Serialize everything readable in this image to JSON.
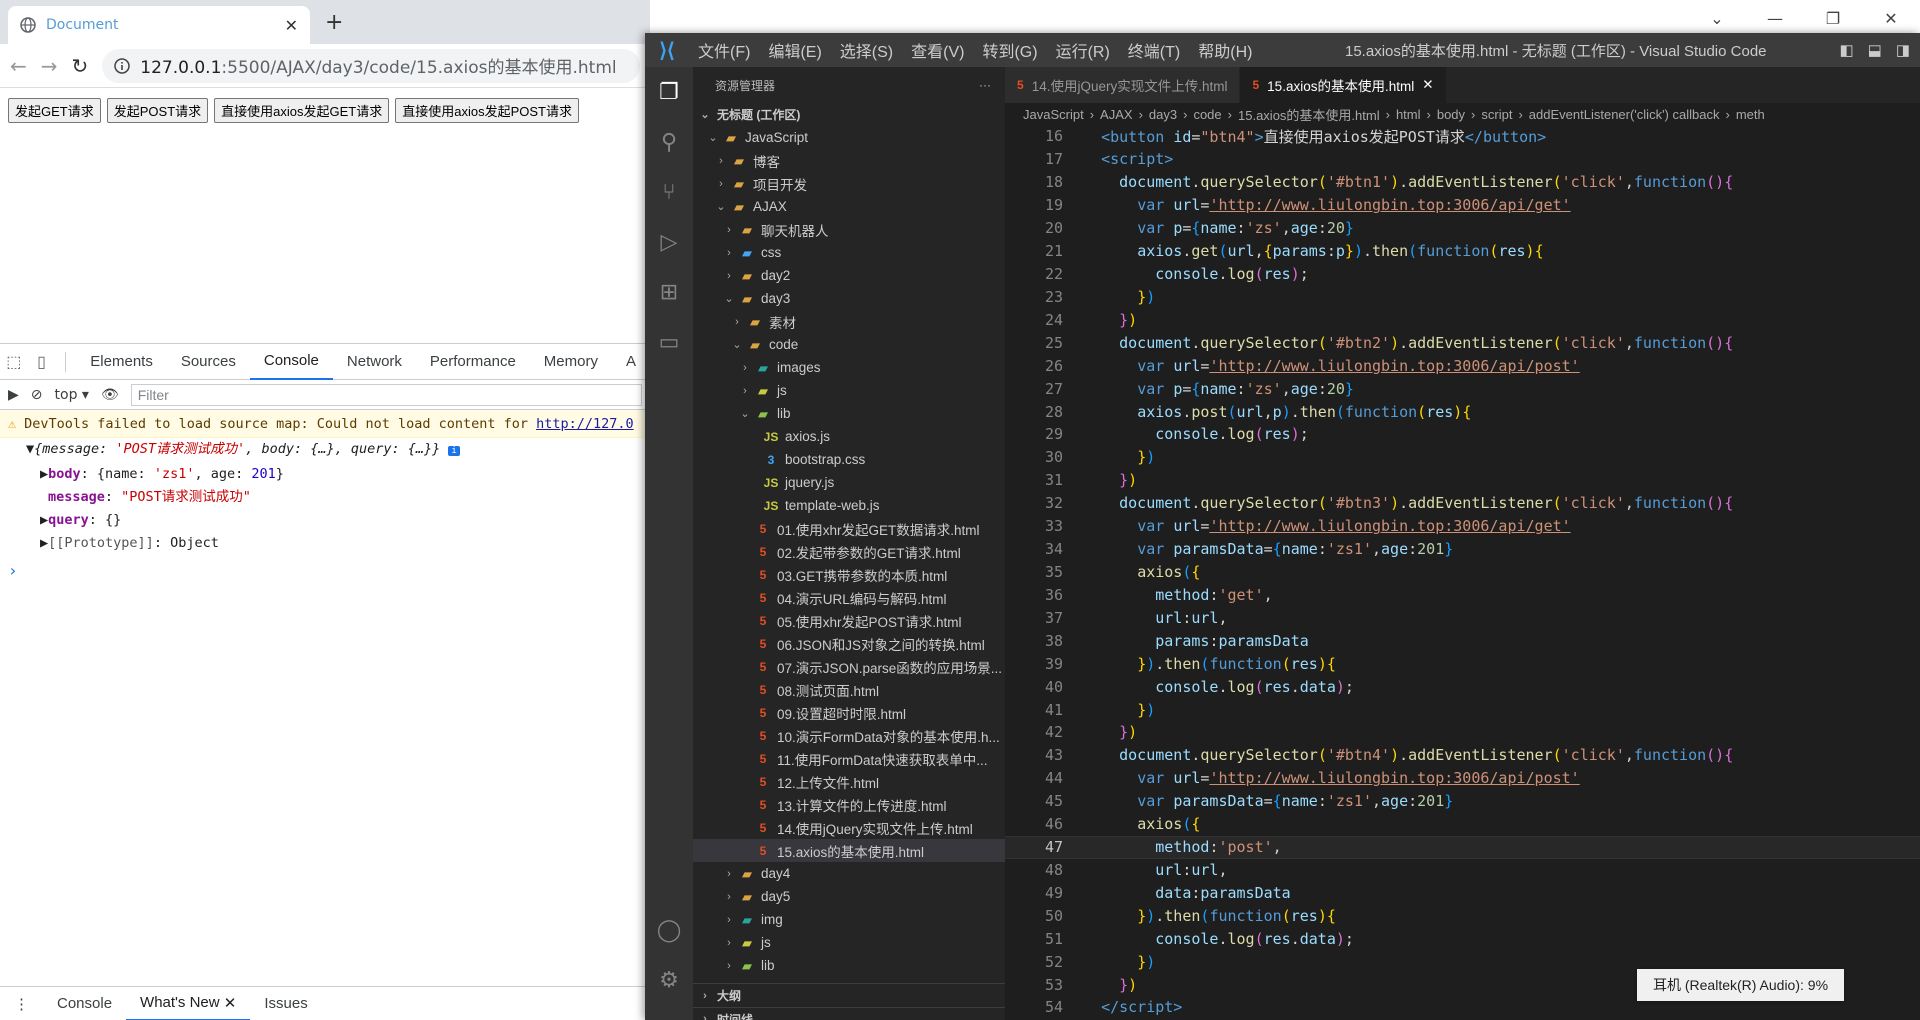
{
  "browser": {
    "tab_title": "Document",
    "url_host": "127.0.0.1",
    "url_path": ":5500/AJAX/day3/code/15.axios的基本使用.html",
    "page_buttons": [
      "发起GET请求",
      "发起POST请求",
      "直接使用axios发起GET请求",
      "直接使用axios发起POST请求"
    ]
  },
  "devtools": {
    "tabs": [
      "Elements",
      "Sources",
      "Console",
      "Network",
      "Performance",
      "Memory",
      "A"
    ],
    "active_tab": "Console",
    "context": "top",
    "filter_placeholder": "Filter",
    "warning_text": "DevTools failed to load source map: Could not load content for",
    "warning_link": "http://127.0",
    "log": {
      "summary_prefix": "{message: ",
      "summary_message": "'POST请求测试成功'",
      "summary_rest": ", body: {…}, query: {…}}",
      "body_key": "body",
      "body_val_pre": "{name: ",
      "body_name": "'zs1'",
      "body_mid": ", age: ",
      "body_age": "201",
      "body_end": "}",
      "message_key": "message",
      "message_val": "\"POST请求测试成功\"",
      "query_key": "query",
      "query_val": "{}",
      "proto_key": "[[Prototype]]",
      "proto_val": "Object"
    },
    "drawer_tabs": [
      "Console",
      "What's New",
      "Issues"
    ]
  },
  "vscode": {
    "menu": [
      "文件(F)",
      "编辑(E)",
      "选择(S)",
      "查看(V)",
      "转到(G)",
      "运行(R)",
      "终端(T)",
      "帮助(H)"
    ],
    "window_title": "15.axios的基本使用.html - 无标题 (工作区) - Visual Studio Code",
    "explorer_title": "资源管理器",
    "workspace": "无标题 (工作区)",
    "tree": [
      {
        "indent": 1,
        "type": "folder",
        "open": true,
        "name": "JavaScript"
      },
      {
        "indent": 2,
        "type": "folder",
        "open": false,
        "name": "博客"
      },
      {
        "indent": 2,
        "type": "folder",
        "open": false,
        "name": "项目开发"
      },
      {
        "indent": 2,
        "type": "folder",
        "open": true,
        "name": "AJAX"
      },
      {
        "indent": 3,
        "type": "folder",
        "open": false,
        "name": "聊天机器人"
      },
      {
        "indent": 3,
        "type": "folder-css",
        "open": false,
        "name": "css"
      },
      {
        "indent": 3,
        "type": "folder",
        "open": false,
        "name": "day2"
      },
      {
        "indent": 3,
        "type": "folder",
        "open": true,
        "name": "day3"
      },
      {
        "indent": 4,
        "type": "folder",
        "open": false,
        "name": "素材"
      },
      {
        "indent": 4,
        "type": "folder",
        "open": true,
        "name": "code"
      },
      {
        "indent": 5,
        "type": "folder-img",
        "open": false,
        "name": "images"
      },
      {
        "indent": 5,
        "type": "folder-js",
        "open": false,
        "name": "js"
      },
      {
        "indent": 5,
        "type": "folder-lib",
        "open": true,
        "name": "lib"
      },
      {
        "indent": 6,
        "type": "js",
        "name": "axios.js"
      },
      {
        "indent": 6,
        "type": "css",
        "name": "bootstrap.css"
      },
      {
        "indent": 6,
        "type": "js",
        "name": "jquery.js"
      },
      {
        "indent": 6,
        "type": "js",
        "name": "template-web.js"
      },
      {
        "indent": 5,
        "type": "html",
        "name": "01.使用xhr发起GET数据请求.html"
      },
      {
        "indent": 5,
        "type": "html",
        "name": "02.发起带参数的GET请求.html"
      },
      {
        "indent": 5,
        "type": "html",
        "name": "03.GET携带参数的本质.html"
      },
      {
        "indent": 5,
        "type": "html",
        "name": "04.演示URL编码与解码.html"
      },
      {
        "indent": 5,
        "type": "html",
        "name": "05.使用xhr发起POST请求.html"
      },
      {
        "indent": 5,
        "type": "html",
        "name": "06.JSON和JS对象之间的转换.html"
      },
      {
        "indent": 5,
        "type": "html",
        "name": "07.演示JSON.parse函数的应用场景..."
      },
      {
        "indent": 5,
        "type": "html",
        "name": "08.测试页面.html"
      },
      {
        "indent": 5,
        "type": "html",
        "name": "09.设置超时时限.html"
      },
      {
        "indent": 5,
        "type": "html",
        "name": "10.演示FormData对象的基本使用.h..."
      },
      {
        "indent": 5,
        "type": "html",
        "name": "11.使用FormData快速获取表单中..."
      },
      {
        "indent": 5,
        "type": "html",
        "name": "12.上传文件.html"
      },
      {
        "indent": 5,
        "type": "html",
        "name": "13.计算文件的上传进度.html"
      },
      {
        "indent": 5,
        "type": "html",
        "name": "14.使用jQuery实现文件上传.html"
      },
      {
        "indent": 5,
        "type": "html",
        "name": "15.axios的基本使用.html",
        "selected": true
      },
      {
        "indent": 3,
        "type": "folder",
        "open": false,
        "name": "day4"
      },
      {
        "indent": 3,
        "type": "folder",
        "open": false,
        "name": "day5"
      },
      {
        "indent": 3,
        "type": "folder-img",
        "open": false,
        "name": "img"
      },
      {
        "indent": 3,
        "type": "folder-js",
        "open": false,
        "name": "js"
      },
      {
        "indent": 3,
        "type": "folder-lib",
        "open": false,
        "name": "lib"
      }
    ],
    "outline": "大纲",
    "timeline": "时间线",
    "editor_tabs": [
      {
        "name": "14.使用jQuery实现文件上传.html",
        "active": false
      },
      {
        "name": "15.axios的基本使用.html",
        "active": true
      }
    ],
    "breadcrumbs": [
      "JavaScript",
      "AJAX",
      "day3",
      "code",
      "15.axios的基本使用.html",
      "html",
      "body",
      "script",
      "addEventListener('click') callback",
      "meth"
    ],
    "current_line": 47,
    "code_lines": [
      {
        "n": 16,
        "html": "  <span class='t'>&lt;button</span> <span class='a'>id</span>=<span class='s'>\"btn4\"</span><span class='t'>&gt;</span>直接使用axios发起POST请求<span class='t'>&lt;/button&gt;</span>"
      },
      {
        "n": 17,
        "html": "  <span class='t'>&lt;script&gt;</span>"
      },
      {
        "n": 18,
        "html": "    <span class='v'>document</span>.<span class='fn'>querySelector</span><span class='b1'>(</span><span class='s'>'#btn1'</span><span class='b1'>)</span>.<span class='fn'>addEventListener</span><span class='b1'>(</span><span class='s'>'click'</span>,<span class='kw'>function</span><span class='b2'>()</span><span class='b2'>{</span>"
      },
      {
        "n": 19,
        "html": "      <span class='kw'>var</span> <span class='v'>url</span>=<span class='lnk'>'http://www.liulongbin.top:3006/api/get'</span>"
      },
      {
        "n": 20,
        "html": "      <span class='kw'>var</span> <span class='v'>p</span>=<span class='b3'>{</span><span class='v'>name</span>:<span class='s'>'zs'</span>,<span class='v'>age</span>:<span class='n'>20</span><span class='b3'>}</span>"
      },
      {
        "n": 21,
        "html": "      <span class='v'>axios</span>.<span class='fn'>get</span><span class='b3'>(</span><span class='v'>url</span>,<span class='b1'>{</span><span class='v'>params</span>:<span class='v'>p</span><span class='b1'>}</span><span class='b3'>)</span>.<span class='fn'>then</span><span class='b3'>(</span><span class='kw'>function</span><span class='b1'>(</span><span class='v'>res</span><span class='b1'>)</span><span class='b1'>{</span>"
      },
      {
        "n": 22,
        "html": "        <span class='v'>console</span>.<span class='fn'>log</span><span class='b2'>(</span><span class='v'>res</span><span class='b2'>)</span>;"
      },
      {
        "n": 23,
        "html": "      <span class='b1'>}</span><span class='b3'>)</span>"
      },
      {
        "n": 24,
        "html": "    <span class='b2'>}</span><span class='b1'>)</span>"
      },
      {
        "n": 25,
        "html": "    <span class='v'>document</span>.<span class='fn'>querySelector</span><span class='b1'>(</span><span class='s'>'#btn2'</span><span class='b1'>)</span>.<span class='fn'>addEventListener</span><span class='b1'>(</span><span class='s'>'click'</span>,<span class='kw'>function</span><span class='b2'>()</span><span class='b2'>{</span>"
      },
      {
        "n": 26,
        "html": "      <span class='kw'>var</span> <span class='v'>url</span>=<span class='lnk'>'http://www.liulongbin.top:3006/api/post'</span>"
      },
      {
        "n": 27,
        "html": "      <span class='kw'>var</span> <span class='v'>p</span>=<span class='b3'>{</span><span class='v'>name</span>:<span class='s'>'zs'</span>,<span class='v'>age</span>:<span class='n'>20</span><span class='b3'>}</span>"
      },
      {
        "n": 28,
        "html": "      <span class='v'>axios</span>.<span class='fn'>post</span><span class='b3'>(</span><span class='v'>url</span>,<span class='v'>p</span><span class='b3'>)</span>.<span class='fn'>then</span><span class='b3'>(</span><span class='kw'>function</span><span class='b1'>(</span><span class='v'>res</span><span class='b1'>)</span><span class='b1'>{</span>"
      },
      {
        "n": 29,
        "html": "        <span class='v'>console</span>.<span class='fn'>log</span><span class='b2'>(</span><span class='v'>res</span><span class='b2'>)</span>;"
      },
      {
        "n": 30,
        "html": "      <span class='b1'>}</span><span class='b3'>)</span>"
      },
      {
        "n": 31,
        "html": "    <span class='b2'>}</span><span class='b1'>)</span>"
      },
      {
        "n": 32,
        "html": "    <span class='v'>document</span>.<span class='fn'>querySelector</span><span class='b1'>(</span><span class='s'>'#btn3'</span><span class='b1'>)</span>.<span class='fn'>addEventListener</span><span class='b1'>(</span><span class='s'>'click'</span>,<span class='kw'>function</span><span class='b2'>()</span><span class='b2'>{</span>"
      },
      {
        "n": 33,
        "html": "      <span class='kw'>var</span> <span class='v'>url</span>=<span class='lnk'>'http://www.liulongbin.top:3006/api/get'</span>"
      },
      {
        "n": 34,
        "html": "      <span class='kw'>var</span> <span class='v'>paramsData</span>=<span class='b3'>{</span><span class='v'>name</span>:<span class='s'>'zs1'</span>,<span class='v'>age</span>:<span class='n'>201</span><span class='b3'>}</span>"
      },
      {
        "n": 35,
        "html": "      <span class='fn'>axios</span><span class='b3'>(</span><span class='b1'>{</span>"
      },
      {
        "n": 36,
        "html": "        <span class='v'>method</span>:<span class='s'>'get'</span>,"
      },
      {
        "n": 37,
        "html": "        <span class='v'>url</span>:<span class='v'>url</span>,"
      },
      {
        "n": 38,
        "html": "        <span class='v'>params</span>:<span class='v'>paramsData</span>"
      },
      {
        "n": 39,
        "html": "      <span class='b1'>}</span><span class='b3'>)</span>.<span class='fn'>then</span><span class='b3'>(</span><span class='kw'>function</span><span class='b1'>(</span><span class='v'>res</span><span class='b1'>)</span><span class='b1'>{</span>"
      },
      {
        "n": 40,
        "html": "        <span class='v'>console</span>.<span class='fn'>log</span><span class='b2'>(</span><span class='v'>res</span>.<span class='v'>data</span><span class='b2'>)</span>;"
      },
      {
        "n": 41,
        "html": "      <span class='b1'>}</span><span class='b3'>)</span>"
      },
      {
        "n": 42,
        "html": "    <span class='b2'>}</span><span class='b1'>)</span>"
      },
      {
        "n": 43,
        "html": "    <span class='v'>document</span>.<span class='fn'>querySelector</span><span class='b1'>(</span><span class='s'>'#btn4'</span><span class='b1'>)</span>.<span class='fn'>addEventListener</span><span class='b1'>(</span><span class='s'>'click'</span>,<span class='kw'>function</span><span class='b2'>()</span><span class='b2'>{</span>"
      },
      {
        "n": 44,
        "html": "      <span class='kw'>var</span> <span class='v'>url</span>=<span class='lnk'>'http://www.liulongbin.top:3006/api/post'</span>"
      },
      {
        "n": 45,
        "html": "      <span class='kw'>var</span> <span class='v'>paramsData</span>=<span class='b3'>{</span><span class='v'>name</span>:<span class='s'>'zs1'</span>,<span class='v'>age</span>:<span class='n'>201</span><span class='b3'>}</span>"
      },
      {
        "n": 46,
        "html": "      <span class='fn'>axios</span><span class='b3'>(</span><span class='b1'>{</span>"
      },
      {
        "n": 47,
        "html": "        <span class='v'>method</span>:<span class='s'>'post'</span>,"
      },
      {
        "n": 48,
        "html": "        <span class='v'>url</span>:<span class='v'>url</span>,"
      },
      {
        "n": 49,
        "html": "        <span class='v'>data</span>:<span class='v'>paramsData</span>"
      },
      {
        "n": 50,
        "html": "      <span class='b1'>}</span><span class='b3'>)</span>.<span class='fn'>then</span><span class='b3'>(</span><span class='kw'>function</span><span class='b1'>(</span><span class='v'>res</span><span class='b1'>)</span><span class='b1'>{</span>"
      },
      {
        "n": 51,
        "html": "        <span class='v'>console</span>.<span class='fn'>log</span><span class='b2'>(</span><span class='v'>res</span>.<span class='v'>data</span><span class='b2'>)</span>;"
      },
      {
        "n": 52,
        "html": "      <span class='b1'>}</span><span class='b3'>)</span>"
      },
      {
        "n": 53,
        "html": "    <span class='b2'>}</span><span class='b1'>)</span>"
      },
      {
        "n": 54,
        "html": "  <span class='t'>&lt;/script&gt;</span>"
      }
    ]
  },
  "notification": "耳机 (Realtek(R) Audio): 9%"
}
